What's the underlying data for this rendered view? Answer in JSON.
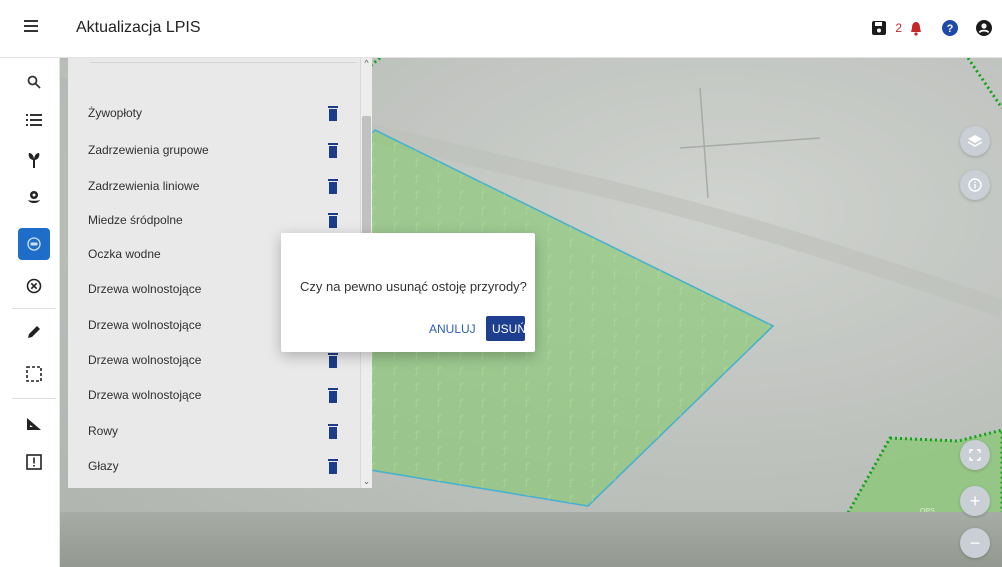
{
  "app": {
    "title": "Aktualizacja LPIS"
  },
  "header": {
    "notification_count": "2",
    "icons": [
      "menu-icon",
      "save-icon",
      "bell-icon",
      "help-icon",
      "user-icon"
    ]
  },
  "rail": {
    "tools": [
      "search-icon",
      "list-icon",
      "plant-icon",
      "flower-icon",
      "active-tool-icon",
      "cancel-icon",
      "pencil-icon",
      "selection-icon",
      "ruler-icon",
      "alert-icon"
    ]
  },
  "panel": {
    "items": [
      {
        "label": "Żywopłoty"
      },
      {
        "label": "Zadrzewienia grupowe"
      },
      {
        "label": "Zadrzewienia liniowe"
      },
      {
        "label": "Miedze śródpolne"
      },
      {
        "label": "Oczka wodne"
      },
      {
        "label": "Drzewa wolnostojące"
      },
      {
        "label": "Drzewa wolnostojące"
      },
      {
        "label": "Drzewa wolnostojące"
      },
      {
        "label": "Drzewa wolnostojące"
      },
      {
        "label": "Rowy"
      },
      {
        "label": "Głazy"
      }
    ]
  },
  "dialog": {
    "message": "Czy na pewno usunąć ostoję przyrody?",
    "cancel_label": "ANULUJ",
    "delete_label": "USUŃ"
  },
  "map_labels": {
    "ops": "OPS"
  },
  "colors": {
    "primary": "#1e3f8f",
    "accent": "#1e6dc9",
    "polygon": "#8fd27a",
    "dotted_line": "#12a81c"
  }
}
